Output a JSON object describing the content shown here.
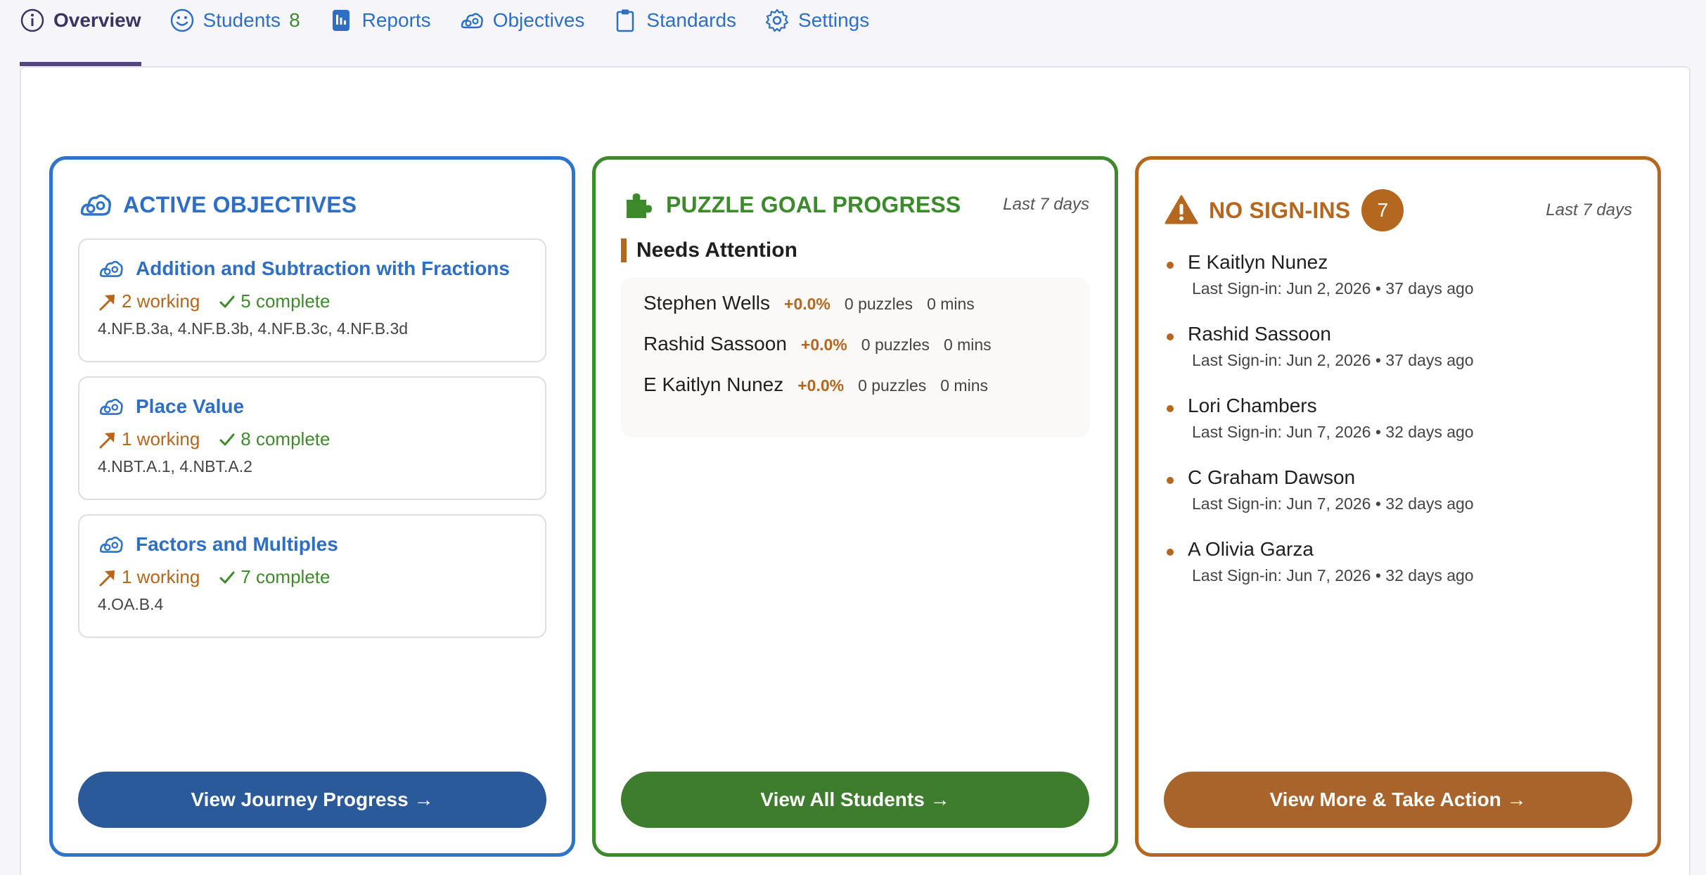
{
  "tabs": [
    {
      "label": "Overview",
      "icon": "info-icon",
      "active": true
    },
    {
      "label": "Students",
      "count": "8",
      "icon": "smiley-icon"
    },
    {
      "label": "Reports",
      "icon": "report-icon"
    },
    {
      "label": "Objectives",
      "icon": "objectives-icon"
    },
    {
      "label": "Standards",
      "icon": "clipboard-icon"
    },
    {
      "label": "Settings",
      "icon": "gear-icon"
    }
  ],
  "active_objectives": {
    "title": "ACTIVE OBJECTIVES",
    "items": [
      {
        "title": "Addition and Subtraction with Fractions",
        "working": "2 working",
        "complete": "5 complete",
        "codes": "4.NF.B.3a, 4.NF.B.3b, 4.NF.B.3c, 4.NF.B.3d"
      },
      {
        "title": "Place Value",
        "working": "1 working",
        "complete": "8 complete",
        "codes": "4.NBT.A.1, 4.NBT.A.2"
      },
      {
        "title": "Factors and Multiples",
        "working": "1 working",
        "complete": "7 complete",
        "codes": "4.OA.B.4"
      }
    ],
    "button": "View Journey Progress →"
  },
  "puzzle_goal": {
    "title": "PUZZLE GOAL PROGRESS",
    "range": "Last 7 days",
    "section": "Needs Attention",
    "rows": [
      {
        "name": "Stephen Wells",
        "pct": "+0.0%",
        "puzzles": "0 puzzles",
        "mins": "0 mins"
      },
      {
        "name": "Rashid Sassoon",
        "pct": "+0.0%",
        "puzzles": "0 puzzles",
        "mins": "0 mins"
      },
      {
        "name": "E Kaitlyn Nunez",
        "pct": "+0.0%",
        "puzzles": "0 puzzles",
        "mins": "0 mins"
      }
    ],
    "button": "View All Students →"
  },
  "no_signins": {
    "title": "NO SIGN-INS",
    "count": "7",
    "range": "Last 7 days",
    "students": [
      {
        "name": "E Kaitlyn Nunez",
        "last": "Last Sign-in: Jun 2, 2026 • 37 days ago"
      },
      {
        "name": "Rashid Sassoon",
        "last": "Last Sign-in: Jun 2, 2026 • 37 days ago"
      },
      {
        "name": "Lori Chambers",
        "last": "Last Sign-in: Jun 7, 2026 • 32 days ago"
      },
      {
        "name": "C Graham Dawson",
        "last": "Last Sign-in: Jun 7, 2026 • 32 days ago"
      },
      {
        "name": "A Olivia Garza",
        "last": "Last Sign-in: Jun 7, 2026 • 32 days ago"
      }
    ],
    "button": "View More & Take Action →"
  },
  "colors": {
    "blue": "#2f74c8",
    "green": "#3c8a2c",
    "orange": "#b3671f",
    "nav_active": "#55467e"
  }
}
